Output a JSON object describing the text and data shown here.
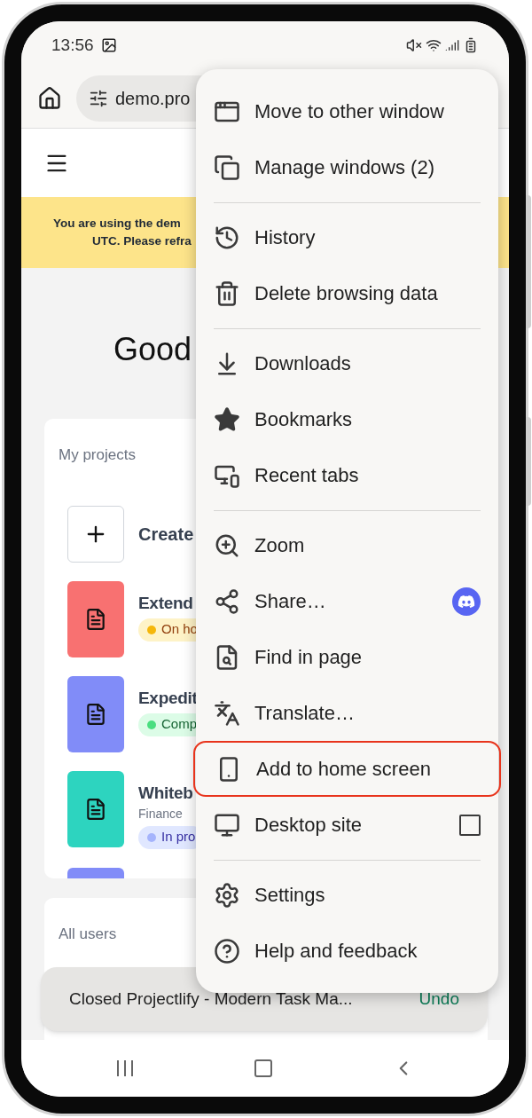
{
  "status_bar": {
    "time": "13:56"
  },
  "address_bar": {
    "url": "demo.pro"
  },
  "banner": {
    "lines": [
      "You are using the dem",
      "UTC. Please refra"
    ]
  },
  "greeting": "Good",
  "projects_card": {
    "title": "My projects",
    "create_label": "Create",
    "projects": [
      {
        "color": "#f87171",
        "title": "Extend",
        "badge": {
          "kind": "on-hold",
          "label": "On ho"
        }
      },
      {
        "color": "#818cf8",
        "title": "Expedit",
        "badge": {
          "kind": "completed",
          "label": "Comp"
        }
      },
      {
        "color": "#2dd4bf",
        "title": "Whiteb",
        "subtitle": "Finance",
        "badge": {
          "kind": "in-progress",
          "label": "In pro"
        }
      },
      {
        "color": "#818cf8"
      }
    ]
  },
  "users_card": {
    "title": "All users"
  },
  "menu": {
    "groups": [
      [
        {
          "kind": "plain",
          "label": "Move to other window",
          "highlighted": false
        },
        {
          "kind": "plain",
          "label": "Manage windows (2)",
          "highlighted": false
        }
      ],
      [
        {
          "kind": "plain",
          "label": "History",
          "highlighted": false
        },
        {
          "kind": "plain",
          "label": "Delete browsing data",
          "highlighted": false
        }
      ],
      [
        {
          "kind": "plain",
          "label": "Downloads",
          "highlighted": false
        },
        {
          "kind": "plain",
          "label": "Bookmarks",
          "highlighted": false
        },
        {
          "kind": "plain",
          "label": "Recent tabs",
          "highlighted": false
        }
      ],
      [
        {
          "kind": "plain",
          "label": "Zoom",
          "highlighted": false
        },
        {
          "kind": "app-shortcut",
          "label": "Share…",
          "highlighted": false
        },
        {
          "kind": "plain",
          "label": "Find in page",
          "highlighted": false
        },
        {
          "kind": "plain",
          "label": "Translate…",
          "highlighted": false
        },
        {
          "kind": "plain",
          "label": "Add to home screen",
          "highlighted": true
        },
        {
          "kind": "checkbox",
          "label": "Desktop site",
          "checked": false,
          "highlighted": false
        }
      ],
      [
        {
          "kind": "plain",
          "label": "Settings",
          "highlighted": false
        },
        {
          "kind": "plain",
          "label": "Help and feedback",
          "highlighted": false
        }
      ]
    ]
  },
  "snackbar": {
    "message": "Closed Projectlify - Modern Task Ma...",
    "action": "Undo"
  }
}
